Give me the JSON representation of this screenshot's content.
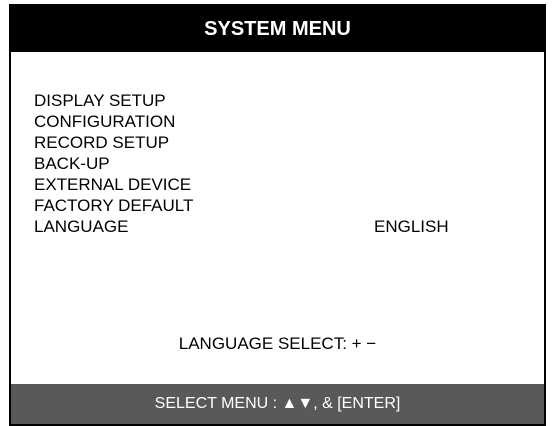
{
  "title": "SYSTEM MENU",
  "menu": {
    "items": [
      {
        "label": "DISPLAY SETUP"
      },
      {
        "label": "CONFIGURATION"
      },
      {
        "label": "RECORD SETUP"
      },
      {
        "label": "BACK-UP"
      },
      {
        "label": "EXTERNAL DEVICE"
      },
      {
        "label": "FACTORY DEFAULT"
      },
      {
        "label": "LANGUAGE",
        "value": "ENGLISH"
      }
    ]
  },
  "hint": "LANGUAGE SELECT: + −",
  "status_bar": "SELECT MENU :  ▲▼, & [ENTER]",
  "colors": {
    "title_bg": "#000000",
    "status_bg": "#595959",
    "border": "#000000"
  }
}
